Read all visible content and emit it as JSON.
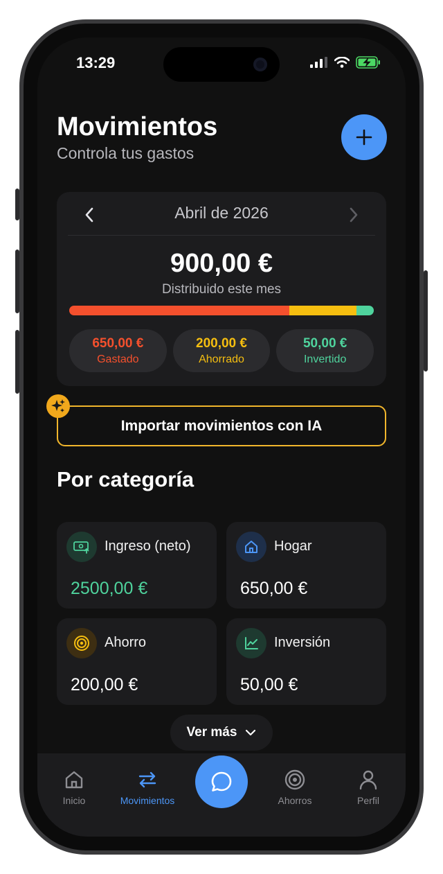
{
  "status": {
    "time": "13:29"
  },
  "header": {
    "title": "Movimientos",
    "subtitle": "Controla tus gastos"
  },
  "summary": {
    "month": "Abril de 2026",
    "total": "900,00 €",
    "total_label": "Distribuido este mes",
    "bar": [
      {
        "key": "gastado",
        "fraction": 0.722,
        "color": "#f4502d"
      },
      {
        "key": "ahorrado",
        "fraction": 0.222,
        "color": "#f5be10"
      },
      {
        "key": "invertido",
        "fraction": 0.056,
        "color": "#4fd39d"
      }
    ],
    "pills": [
      {
        "amount": "650,00 €",
        "label": "Gastado",
        "color": "#f4502d"
      },
      {
        "amount": "200,00 €",
        "label": "Ahorrado",
        "color": "#f5be10"
      },
      {
        "amount": "50,00 €",
        "label": "Invertido",
        "color": "#4fd39d"
      }
    ]
  },
  "ai_import": {
    "label": "Importar movimientos con IA",
    "icon": "sparkles-icon"
  },
  "section": {
    "title": "Por categoría"
  },
  "categories": [
    {
      "name": "Ingreso (neto)",
      "value": "2500,00 €",
      "icon": "money-icon",
      "value_color": "#4fd39d"
    },
    {
      "name": "Hogar",
      "value": "650,00 €",
      "icon": "home-icon",
      "value_color": "#ffffff"
    },
    {
      "name": "Ahorro",
      "value": "200,00 €",
      "icon": "target-icon",
      "value_color": "#ffffff"
    },
    {
      "name": "Inversión",
      "value": "50,00 €",
      "icon": "chart-line-icon",
      "value_color": "#ffffff"
    }
  ],
  "more": {
    "label": "Ver más"
  },
  "tabs": [
    {
      "label": "Inicio",
      "icon": "home-icon",
      "active": false
    },
    {
      "label": "Movimientos",
      "icon": "arrows-swap-icon",
      "active": true
    },
    {
      "label": "Ahorros",
      "icon": "target-icon",
      "active": false
    },
    {
      "label": "Perfil",
      "icon": "user-icon",
      "active": false
    }
  ],
  "colors": {
    "accent": "#4c96f7",
    "background": "#111111",
    "card": "#1c1c1e",
    "ai_border": "#f1b62c"
  }
}
